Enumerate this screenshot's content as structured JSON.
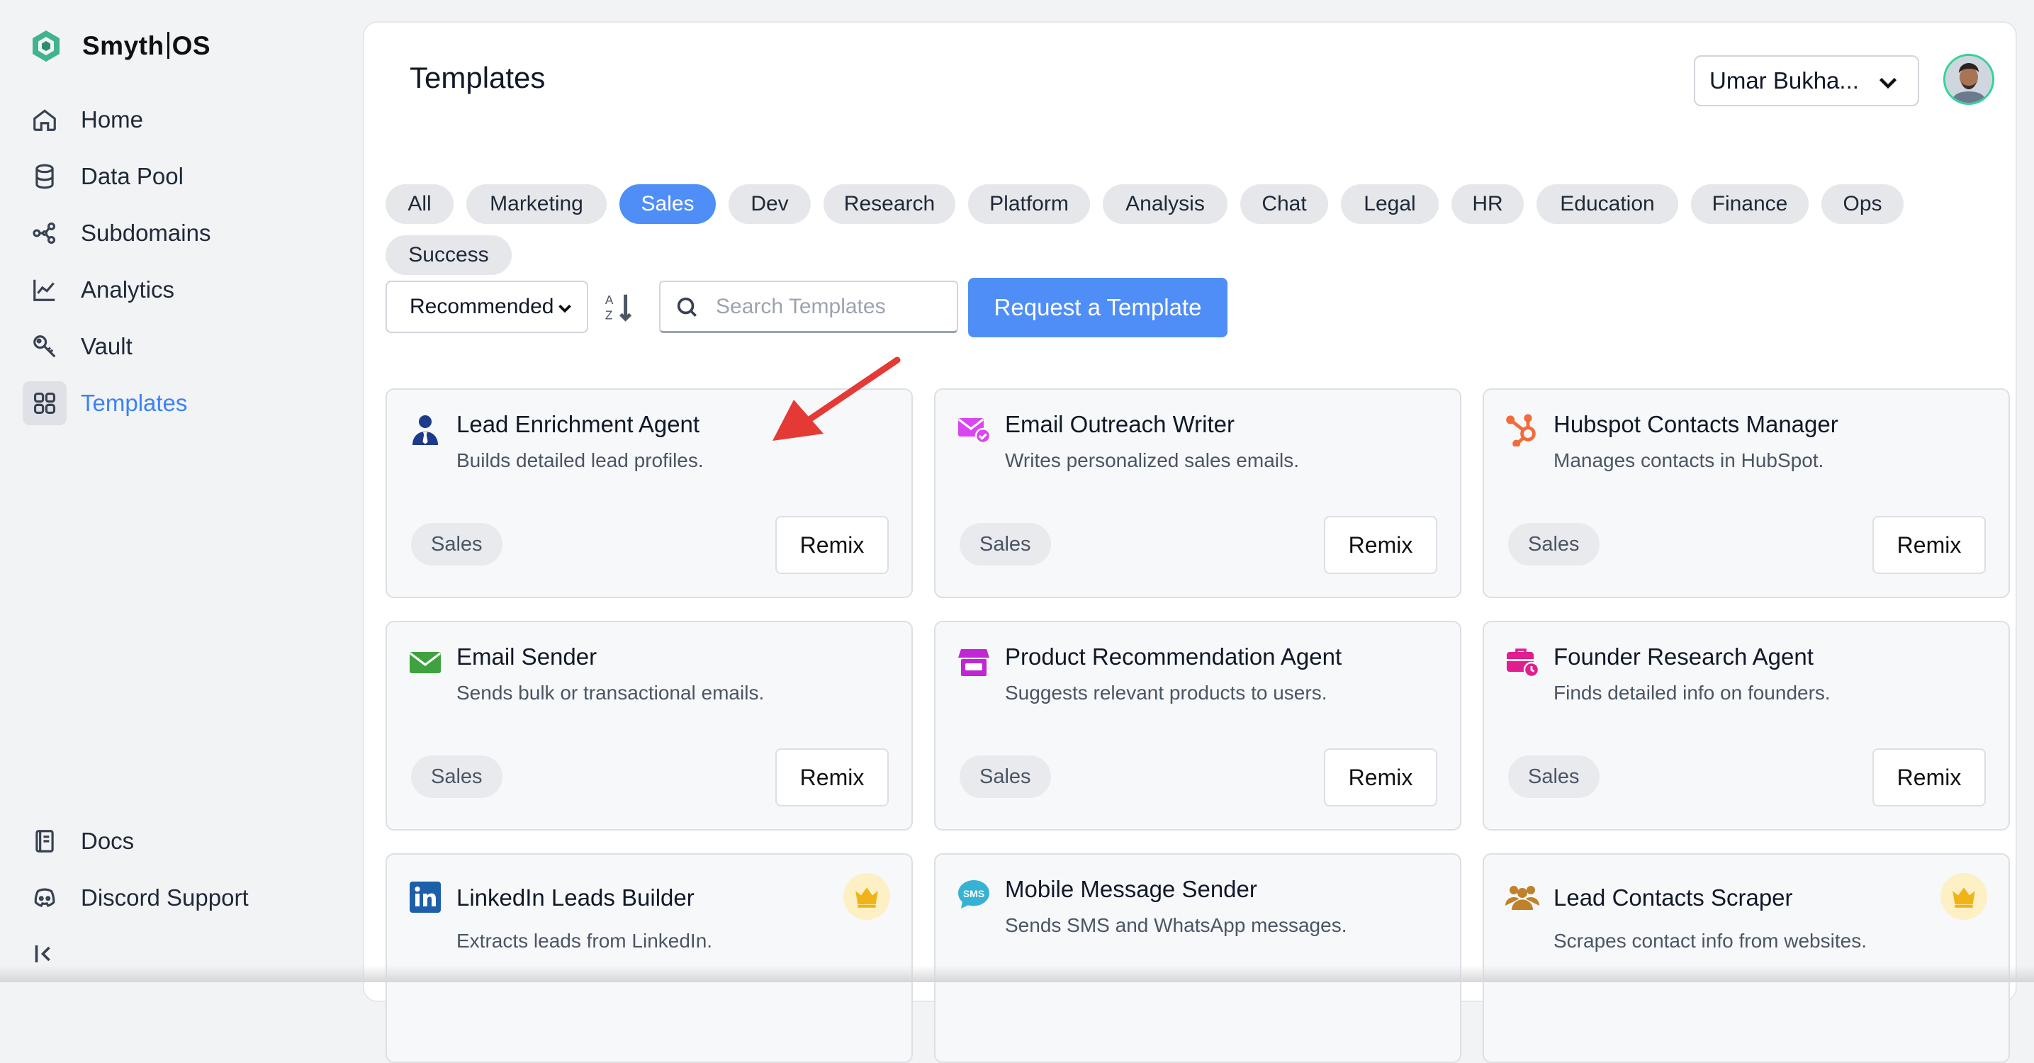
{
  "app": {
    "logo_left": "Smyth",
    "logo_right": "OS"
  },
  "sidebar": {
    "items": [
      {
        "label": "Home",
        "icon": "home-icon"
      },
      {
        "label": "Data Pool",
        "icon": "database-icon"
      },
      {
        "label": "Subdomains",
        "icon": "network-icon"
      },
      {
        "label": "Analytics",
        "icon": "chart-line-icon"
      },
      {
        "label": "Vault",
        "icon": "key-icon"
      },
      {
        "label": "Templates",
        "icon": "grid-icon",
        "active": true
      }
    ],
    "footer": [
      {
        "label": "Docs",
        "icon": "book-icon"
      },
      {
        "label": "Discord Support",
        "icon": "discord-icon"
      }
    ]
  },
  "header": {
    "title": "Templates",
    "user_name": "Umar Bukha..."
  },
  "filters": {
    "categories": [
      "All",
      "Marketing",
      "Sales",
      "Dev",
      "Research",
      "Platform",
      "Analysis",
      "Chat",
      "Legal",
      "HR",
      "Education",
      "Finance",
      "Ops",
      "Success"
    ],
    "active": "Sales"
  },
  "toolbar": {
    "sort_value": "Recommended",
    "search_placeholder": "Search Templates",
    "request_label": "Request a Template"
  },
  "cards": [
    {
      "title": "Lead Enrichment Agent",
      "desc": "Builds detailed lead profiles.",
      "tag": "Sales",
      "remix": "Remix",
      "icon": "user-suit-icon"
    },
    {
      "title": "Email Outreach Writer",
      "desc": "Writes personalized sales emails.",
      "tag": "Sales",
      "remix": "Remix",
      "icon": "mail-check-icon"
    },
    {
      "title": "Hubspot Contacts Manager",
      "desc": "Manages contacts in HubSpot.",
      "tag": "Sales",
      "remix": "Remix",
      "icon": "hubspot-icon"
    },
    {
      "title": "Email Sender",
      "desc": "Sends bulk or transactional emails.",
      "tag": "Sales",
      "remix": "Remix",
      "icon": "envelope-icon"
    },
    {
      "title": "Product Recommendation Agent",
      "desc": "Suggests relevant products to users.",
      "tag": "Sales",
      "remix": "Remix",
      "icon": "store-icon"
    },
    {
      "title": "Founder Research Agent",
      "desc": "Finds detailed info on founders.",
      "tag": "Sales",
      "remix": "Remix",
      "icon": "briefcase-clock-icon"
    },
    {
      "title": "LinkedIn Leads Builder",
      "desc": "Extracts leads from LinkedIn.",
      "icon": "linkedin-icon",
      "premium": true
    },
    {
      "title": "Mobile Message Sender",
      "desc": "Sends SMS and WhatsApp messages.",
      "icon": "sms-icon"
    },
    {
      "title": "Lead Contacts Scraper",
      "desc": "Scrapes contact info from websites.",
      "icon": "users-icon",
      "premium": true
    }
  ],
  "colors": {
    "accent": "#4f8ef7",
    "active_nav_text": "#3b82f6",
    "annotation_arrow": "#e53935"
  }
}
